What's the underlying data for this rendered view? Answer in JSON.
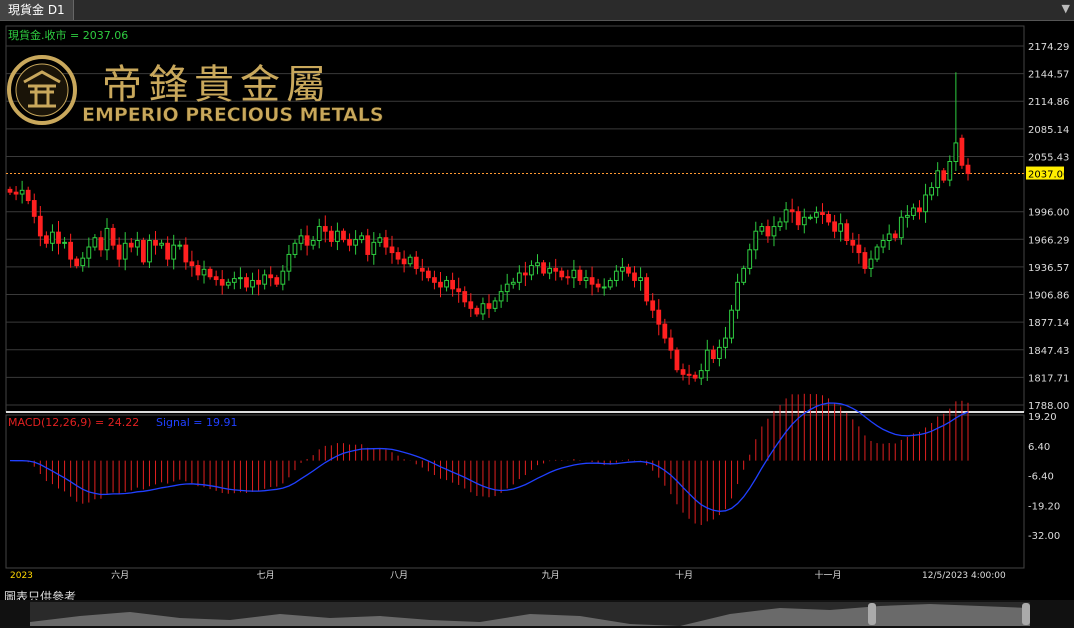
{
  "window": {
    "tab_title": "現貨金 D1"
  },
  "price_panel": {
    "legend": "現貨金.收市 = 2037.06"
  },
  "logo": {
    "chinese": "帝鋒貴金屬",
    "english": "EMPERIO PRECIOUS METALS",
    "colors": {
      "gold": "#c9a85c"
    }
  },
  "macd_panel": {
    "label_macd": "MACD(12,26,9) = 24.22",
    "label_signal": "Signal = 19.91"
  },
  "footer": {
    "disclaimer": "圖表只供參考"
  },
  "colors": {
    "up": "#2ecc40",
    "down": "#ff2020",
    "macd_bar": "#e02020",
    "signal": "#2040ff",
    "last_price_line": "#ff9933",
    "grid": "#3a3a3a"
  },
  "icons": {
    "tab_menu": "dropdown-arrow-icon"
  },
  "chart_data": [
    {
      "type": "candlestick",
      "title": "現貨金.收市 = 2037.06",
      "last_price": 2037.06,
      "ylim": [
        1788.0,
        2174.29
      ],
      "ytick_labels": [
        "2174.29",
        "2144.57",
        "2114.86",
        "2085.14",
        "2055.43",
        "2037.06",
        "1996.00",
        "1966.29",
        "1936.57",
        "1906.86",
        "1877.14",
        "1847.43",
        "1817.71",
        "1788.00"
      ],
      "yticks": [
        2174.29,
        2144.57,
        2114.86,
        2085.14,
        2055.43,
        1996.0,
        1966.29,
        1936.57,
        1906.86,
        1877.14,
        1847.43,
        1817.71,
        1788.0
      ],
      "xtick_labels": [
        "2023",
        "六月",
        "七月",
        "八月",
        "九月",
        "十月",
        "十一月",
        "12/5/2023 4:00:00"
      ],
      "xtick_index": [
        0,
        18,
        42,
        64,
        89,
        111,
        134,
        157
      ],
      "closes": [
        2017,
        2015,
        2019,
        2008,
        1991,
        1970,
        1962,
        1974,
        1962,
        1963,
        1945,
        1938,
        1946,
        1958,
        1968,
        1955,
        1978,
        1960,
        1945,
        1962,
        1958,
        1965,
        1942,
        1965,
        1960,
        1962,
        1945,
        1960,
        1960,
        1942,
        1938,
        1928,
        1934,
        1926,
        1923,
        1917,
        1920,
        1924,
        1925,
        1915,
        1922,
        1918,
        1928,
        1925,
        1918,
        1932,
        1950,
        1962,
        1970,
        1960,
        1965,
        1980,
        1975,
        1964,
        1975,
        1966,
        1960,
        1966,
        1970,
        1950,
        1963,
        1968,
        1958,
        1952,
        1945,
        1940,
        1947,
        1935,
        1932,
        1925,
        1920,
        1915,
        1922,
        1913,
        1910,
        1899,
        1892,
        1886,
        1897,
        1892,
        1900,
        1910,
        1918,
        1920,
        1930,
        1928,
        1938,
        1941,
        1930,
        1935,
        1932,
        1926,
        1925,
        1933,
        1922,
        1925,
        1918,
        1915,
        1915,
        1922,
        1932,
        1936,
        1930,
        1922,
        1925,
        1900,
        1890,
        1875,
        1860,
        1847,
        1826,
        1821,
        1820,
        1817,
        1825,
        1847,
        1838,
        1850,
        1860,
        1890,
        1920,
        1935,
        1955,
        1975,
        1980,
        1970,
        1980,
        1985,
        1998,
        1996,
        1982,
        1990,
        1990,
        1995,
        1993,
        1985,
        1975,
        1983,
        1965,
        1960,
        1952,
        1935,
        1945,
        1958,
        1965,
        1972,
        1968,
        1990,
        1992,
        2000,
        1996,
        2014,
        2022,
        2040,
        2030,
        2050,
        2070,
        2046,
        2037
      ],
      "opens": [
        2020,
        2017,
        2015,
        2019,
        2008,
        1991,
        1970,
        1962,
        1974,
        1962,
        1963,
        1945,
        1938,
        1946,
        1958,
        1968,
        1955,
        1978,
        1960,
        1945,
        1962,
        1958,
        1965,
        1942,
        1965,
        1960,
        1962,
        1945,
        1960,
        1960,
        1942,
        1938,
        1928,
        1934,
        1926,
        1923,
        1917,
        1920,
        1924,
        1925,
        1915,
        1922,
        1918,
        1928,
        1925,
        1918,
        1932,
        1950,
        1962,
        1970,
        1960,
        1965,
        1980,
        1975,
        1964,
        1975,
        1966,
        1960,
        1966,
        1970,
        1950,
        1963,
        1968,
        1958,
        1952,
        1945,
        1940,
        1947,
        1935,
        1932,
        1925,
        1920,
        1915,
        1922,
        1913,
        1910,
        1899,
        1892,
        1886,
        1897,
        1892,
        1900,
        1910,
        1918,
        1920,
        1930,
        1928,
        1938,
        1941,
        1930,
        1935,
        1932,
        1926,
        1925,
        1933,
        1922,
        1925,
        1918,
        1915,
        1915,
        1922,
        1932,
        1936,
        1930,
        1922,
        1925,
        1900,
        1890,
        1875,
        1860,
        1847,
        1826,
        1821,
        1820,
        1817,
        1825,
        1847,
        1838,
        1850,
        1860,
        1890,
        1920,
        1935,
        1955,
        1975,
        1980,
        1970,
        1980,
        1985,
        1998,
        1996,
        1982,
        1990,
        1990,
        1995,
        1993,
        1985,
        1975,
        1983,
        1965,
        1960,
        1952,
        1935,
        1945,
        1958,
        1965,
        1972,
        1968,
        1990,
        1992,
        2000,
        1996,
        2014,
        2022,
        2040,
        2030,
        2050,
        2075,
        2046
      ],
      "spike_high": 2146.0
    },
    {
      "type": "macd",
      "title": "MACD(12,26,9) = 24.22",
      "series": [
        {
          "name": "MACD(12,26,9)",
          "last": 24.22
        },
        {
          "name": "Signal",
          "last": 19.91
        }
      ],
      "ylim": [
        -32.0,
        19.2
      ],
      "ytick_labels": [
        "19.20",
        "6.40",
        "-6.40",
        "-19.20",
        "-32.00"
      ],
      "yticks": [
        19.2,
        6.4,
        -6.4,
        -19.2,
        -32.0
      ]
    }
  ]
}
